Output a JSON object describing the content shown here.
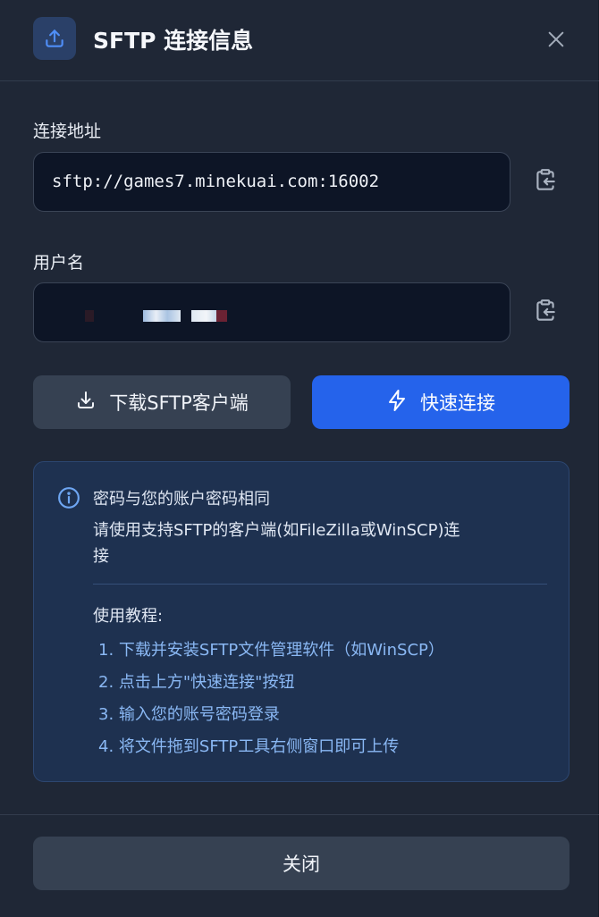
{
  "dialog": {
    "title": "SFTP 连接信息",
    "icons": {
      "header": "upload-icon",
      "close": "close-icon",
      "copy": "clipboard-copy-icon",
      "download": "download-icon",
      "connect": "lightning-icon",
      "info": "info-icon"
    }
  },
  "fields": {
    "address": {
      "label": "连接地址",
      "value": "sftp://games7.minekuai.com:16002"
    },
    "username": {
      "label": "用户名",
      "value": ""
    }
  },
  "actions": {
    "download_label": "下载SFTP客户端",
    "connect_label": "快速连接",
    "close_label": "关闭"
  },
  "info": {
    "line1": "密码与您的账户密码相同",
    "line2a": "请使用支持SFTP的客户端(如FileZilla或WinSCP)连",
    "line2b": "接",
    "tutorial_title": "使用教程:",
    "steps": [
      "1. 下载并安装SFTP文件管理软件（如WinSCP）",
      "2. 点击上方\"快速连接\"按钮",
      "3. 输入您的账号密码登录",
      "4. 将文件拖到SFTP工具右侧窗口即可上传"
    ]
  },
  "colors": {
    "background": "#1f2736",
    "accent": "#2563eb",
    "info_panel": "#1e3150",
    "step_text": "#8ab8f4"
  }
}
